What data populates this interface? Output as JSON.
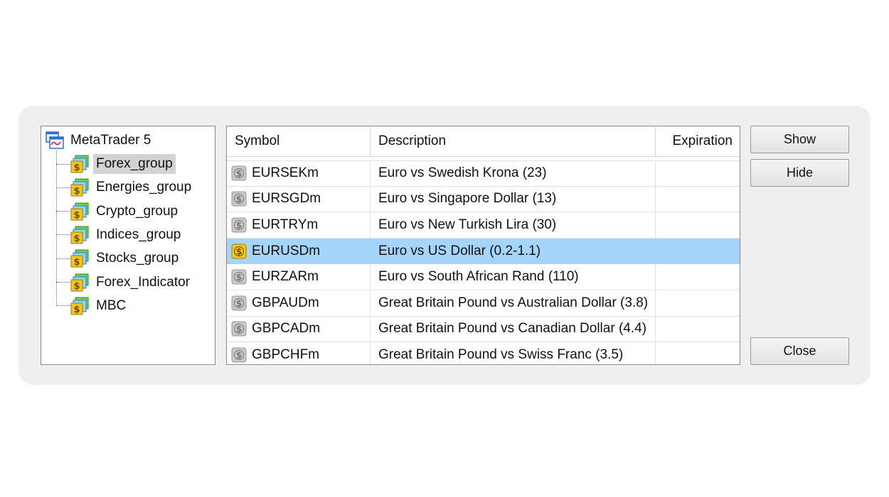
{
  "tree": {
    "root_label": "MetaTrader 5",
    "root_icon": "metatrader-terminal-icon",
    "folder_icon": "symbol-folder-icon",
    "items": [
      {
        "label": "Forex_group",
        "selected": true
      },
      {
        "label": "Energies_group",
        "selected": false
      },
      {
        "label": "Crypto_group",
        "selected": false
      },
      {
        "label": "Indices_group",
        "selected": false
      },
      {
        "label": "Stocks_group",
        "selected": false
      },
      {
        "label": "Forex_Indicator",
        "selected": false
      },
      {
        "label": "MBC",
        "selected": false
      }
    ]
  },
  "table": {
    "columns": {
      "symbol": "Symbol",
      "description": "Description",
      "expiration": "Expiration"
    },
    "rows": [
      {
        "symbol": "EURSEKm",
        "description": "Euro vs Swedish Krona (23)",
        "expiration": "",
        "active": false
      },
      {
        "symbol": "EURSGDm",
        "description": "Euro vs Singapore Dollar (13)",
        "expiration": "",
        "active": false
      },
      {
        "symbol": "EURTRYm",
        "description": "Euro vs New Turkish Lira (30)",
        "expiration": "",
        "active": false
      },
      {
        "symbol": "EURUSDm",
        "description": "Euro vs US Dollar (0.2-1.1)",
        "expiration": "",
        "active": true
      },
      {
        "symbol": "EURZARm",
        "description": "Euro vs South African Rand (110)",
        "expiration": "",
        "active": false
      },
      {
        "symbol": "GBPAUDm",
        "description": "Great Britain Pound vs Australian Dollar (3.8)",
        "expiration": "",
        "active": false
      },
      {
        "symbol": "GBPCADm",
        "description": "Great Britain Pound vs Canadian Dollar (4.4)",
        "expiration": "",
        "active": false
      },
      {
        "symbol": "GBPCHFm",
        "description": "Great Britain Pound vs Swiss Franc (3.5)",
        "expiration": "",
        "active": false
      }
    ]
  },
  "buttons": {
    "show": "Show",
    "hide": "Hide",
    "close": "Close"
  },
  "colors": {
    "selected_row": "#a5d5fb",
    "selected_tree_item": "#d3d3d3",
    "dialog_background": "#efefef",
    "active_symbol_icon": "#f5c518",
    "inactive_symbol_icon": "#c8c8c8"
  }
}
